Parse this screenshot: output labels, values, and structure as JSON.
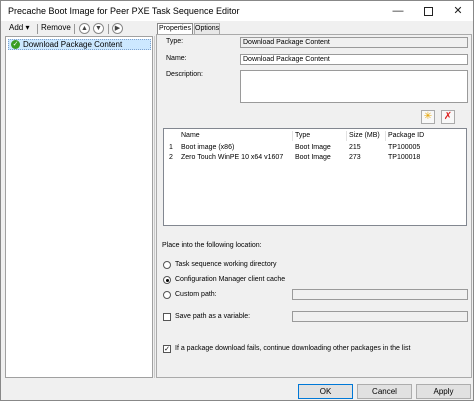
{
  "window": {
    "title": "Precache Boot Image for Peer PXE Task Sequence Editor"
  },
  "toolbar": {
    "add_label": "Add ▾",
    "remove_label": "Remove"
  },
  "tree": {
    "items": [
      {
        "label": "Download Package Content",
        "status_icon": "check-icon"
      }
    ]
  },
  "tabs": [
    {
      "label": "Properties",
      "active": true
    },
    {
      "label": "Options",
      "active": false
    }
  ],
  "properties": {
    "type_label": "Type:",
    "type_value": "Download Package Content",
    "name_label": "Name:",
    "name_value": "Download Package Content",
    "description_label": "Description:",
    "description_value": ""
  },
  "packages": {
    "columns": [
      "Name",
      "Type",
      "Size (MB)",
      "Package ID"
    ],
    "rows": [
      {
        "index": "1",
        "name": "Boot image (x86)",
        "type": "Boot Image",
        "size": "215",
        "id": "TP100005"
      },
      {
        "index": "2",
        "name": "Zero Touch WinPE 10 x64 v1607",
        "type": "Boot Image",
        "size": "273",
        "id": "TP100018"
      }
    ]
  },
  "location": {
    "heading": "Place into the following location:",
    "options": [
      {
        "label": "Task sequence working directory",
        "selected": false
      },
      {
        "label": "Configuration Manager client cache",
        "selected": true
      },
      {
        "label": "Custom path:",
        "selected": false
      }
    ],
    "custom_path_value": "",
    "save_path_label": "Save path as a variable:",
    "save_path_checked": false,
    "save_path_value": ""
  },
  "continue_option": {
    "label": "If a package download fails, continue downloading other packages in the list",
    "checked": true
  },
  "buttons": {
    "ok": "OK",
    "cancel": "Cancel",
    "apply": "Apply"
  },
  "colors": {
    "selection": "#cce8ff",
    "check_green": "#3a9d23",
    "accent": "#0078d7"
  }
}
